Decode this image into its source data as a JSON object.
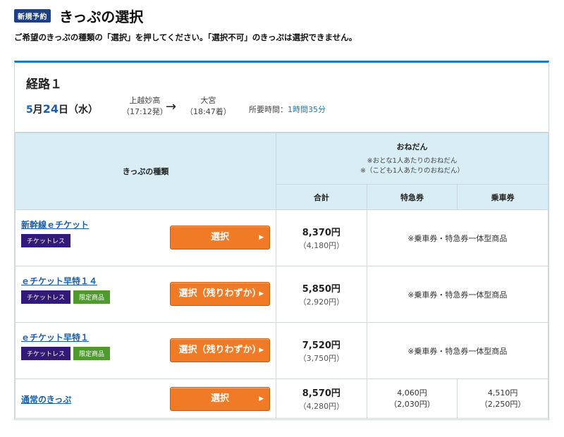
{
  "header": {
    "badge": "新規予約",
    "title": "きっぷの選択"
  },
  "instruction": "ご希望のきっぷの種類の「選択」を押してください。「選択不可」のきっぷは選択できません。",
  "route": {
    "title": "経路１",
    "date_month": "5",
    "date_month_suffix": "月",
    "date_day": "24",
    "date_day_suffix": "日（水）",
    "from_station": "上越妙高",
    "from_time": "（17:12発）",
    "arrow": "→",
    "to_station": "大宮",
    "to_time": "（18:47着）",
    "duration_label": "所要時間：",
    "duration_value": "1時間35分"
  },
  "table": {
    "col_kind": "きっぷの種類",
    "col_price": "おねだん",
    "note_adult": "※おとな1人あたりのおねだん",
    "note_child": "※（こども1人あたりのおねだん）",
    "col_total": "合計",
    "col_express": "特急券",
    "col_base": "乗車券",
    "rows": [
      {
        "name": "新幹線ｅチケット",
        "tags": [
          "チケットレス"
        ],
        "button": "選択",
        "total": "8,370円",
        "child_total": "（4,180円）",
        "combined_note": "※乗車券・特急券一体型商品"
      },
      {
        "name": "ｅチケット早特１４",
        "tags": [
          "チケットレス",
          "限定商品"
        ],
        "button": "選択（残りわずか）",
        "total": "5,850円",
        "child_total": "（2,920円）",
        "combined_note": "※乗車券・特急券一体型商品"
      },
      {
        "name": "ｅチケット早特１",
        "tags": [
          "チケットレス",
          "限定商品"
        ],
        "button": "選択（残りわずか）",
        "total": "7,520円",
        "child_total": "（3,750円）",
        "combined_note": "※乗車券・特急券一体型商品"
      },
      {
        "name": "通常のきっぷ",
        "tags": [],
        "button": "選択",
        "total": "8,570円",
        "child_total": "（4,280円）",
        "express": "4,060円",
        "child_express": "（2,030円）",
        "base": "4,510円",
        "child_base": "（2,250円）"
      }
    ]
  },
  "colors": {
    "accent_blue": "#1b7ac0",
    "button_orange": "#f07a26",
    "tag_ticketless": "#321a7b",
    "tag_limited": "#4e9a2f",
    "header_cell": "#d8eef4"
  }
}
